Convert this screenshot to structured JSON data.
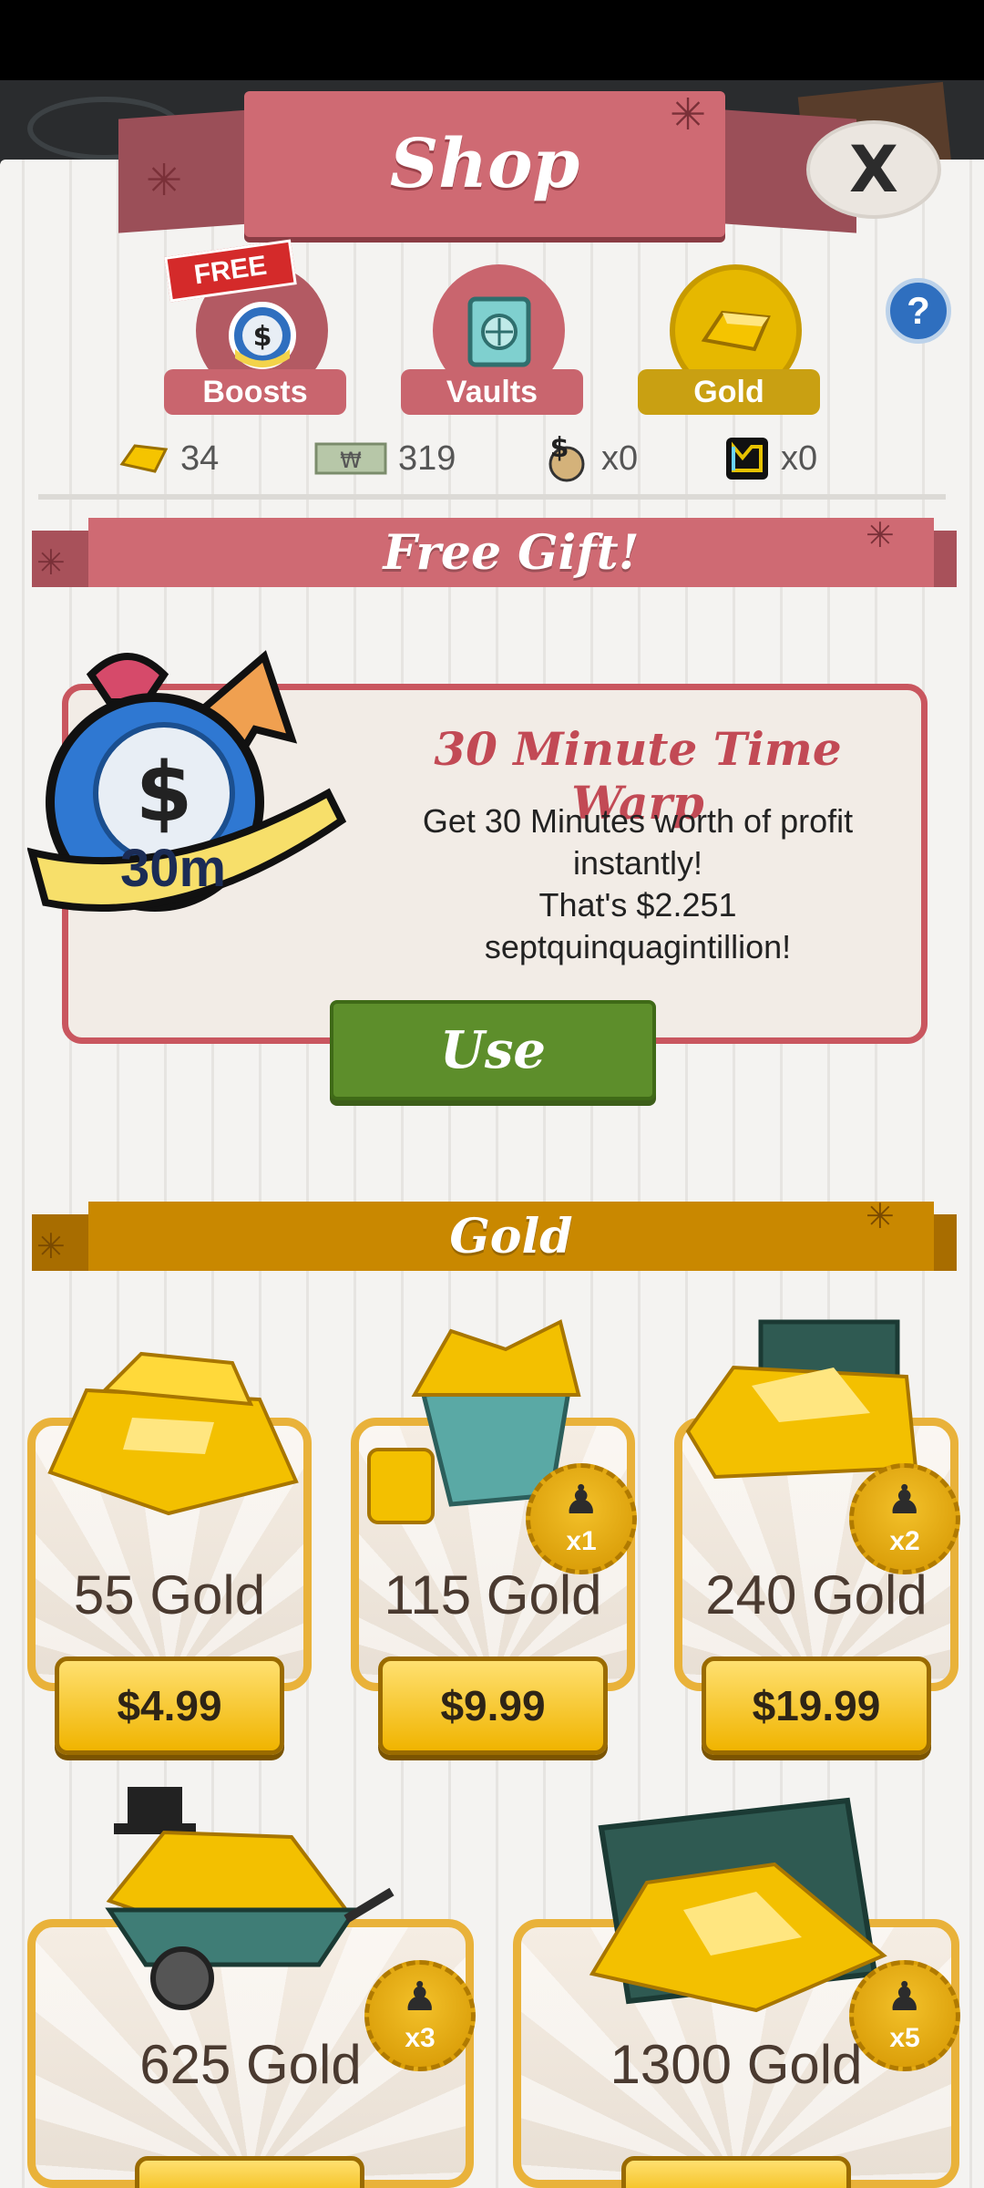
{
  "header": {
    "title": "Shop",
    "close_label": "X"
  },
  "tabs": [
    {
      "label": "Boosts",
      "icon": "stopwatch-bag-icon",
      "flag": "FREE"
    },
    {
      "label": "Vaults",
      "icon": "vault-icon"
    },
    {
      "label": "Gold",
      "icon": "gold-bar-icon",
      "active": true
    }
  ],
  "help_label": "?",
  "currencies": [
    {
      "icon": "gold-icon",
      "value": "34"
    },
    {
      "icon": "cash-icon",
      "value": "319"
    },
    {
      "icon": "money-bag-icon",
      "value": "x0"
    },
    {
      "icon": "mega-ticket-icon",
      "value": "x0"
    }
  ],
  "free_gift": {
    "banner": "Free Gift!",
    "badge": "30m",
    "title": "30 Minute Time Warp",
    "desc_line1": "Get 30 Minutes worth of profit",
    "desc_line2": "instantly!",
    "desc_line3": "That's $2.251 septquinquagintillion!",
    "button": "Use"
  },
  "gold_section": {
    "banner": "Gold",
    "packs": [
      {
        "amount": "55 Gold",
        "price": "$4.99"
      },
      {
        "amount": "115 Gold",
        "price": "$9.99",
        "badge": "x1"
      },
      {
        "amount": "240 Gold",
        "price": "$19.99",
        "badge": "x2"
      },
      {
        "amount": "625 Gold",
        "badge": "x3"
      },
      {
        "amount": "1300 Gold",
        "badge": "x5"
      }
    ]
  },
  "colors": {
    "accent_pink": "#cf6a73",
    "gold": "#e9b23a",
    "use_green": "#5d8e2b"
  }
}
